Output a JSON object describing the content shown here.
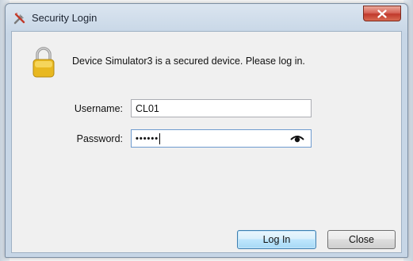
{
  "window": {
    "title": "Security Login",
    "close_glyph": "x"
  },
  "dialog": {
    "message": "Device Simulator3 is a secured device. Please log in.",
    "username_label": "Username:",
    "username_value": "CL01",
    "password_label": "Password:",
    "password_masked": "••••••",
    "login_button": "Log In",
    "close_button": "Close"
  },
  "icons": {
    "title": "tools-icon",
    "lock": "padlock-icon",
    "reveal": "eye-icon"
  },
  "colors": {
    "close_button_red": "#c0392b",
    "default_button_border": "#3c7fb1",
    "lock_gold": "#e8b820"
  }
}
